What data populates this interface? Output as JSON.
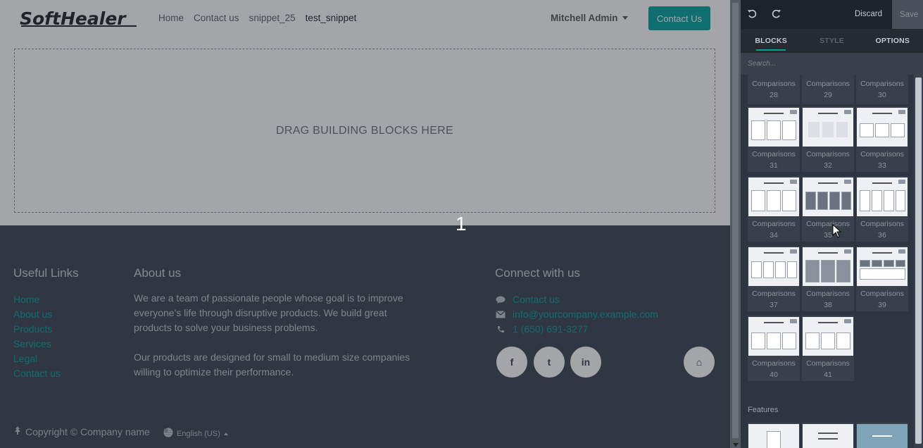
{
  "navbar": {
    "logo_text": "SoftHealer",
    "links": [
      {
        "label": "Home",
        "active": false
      },
      {
        "label": "Contact us",
        "active": false
      },
      {
        "label": "snippet_25",
        "active": false
      },
      {
        "label": "test_snippet",
        "active": true
      }
    ],
    "user": "Mitchell Admin",
    "cta_label": "Contact Us"
  },
  "main": {
    "dropzone_label": "DRAG BUILDING BLOCKS HERE",
    "hover_number": "1"
  },
  "footer": {
    "useful_links": {
      "title": "Useful Links",
      "items": [
        "Home",
        "About us",
        "Products",
        "Services",
        "Legal",
        "Contact us"
      ]
    },
    "about": {
      "title": "About us",
      "p1": "We are a team of passionate people whose goal is to improve everyone's life through disruptive products. We build great products to solve your business problems.",
      "p2": "Our products are designed for small to medium size companies willing to optimize their performance."
    },
    "connect": {
      "title": "Connect with us",
      "contact_label": "Contact us",
      "email": "info@yourcompany.example.com",
      "phone": "1 (650) 691-3277",
      "social": [
        {
          "icon": "facebook-icon",
          "glyph": "f"
        },
        {
          "icon": "twitter-icon",
          "glyph": "t"
        },
        {
          "icon": "linkedin-icon",
          "glyph": "in"
        },
        {
          "icon": "home-icon",
          "glyph": "⌂"
        }
      ]
    },
    "copyright": "Copyright © Company name",
    "language": "English (US)"
  },
  "editor": {
    "discard_label": "Discard",
    "save_label": "Save",
    "tabs": [
      "BLOCKS",
      "STYLE",
      "OPTIONS"
    ],
    "active_tab": "BLOCKS",
    "search_placeholder": "Search...",
    "blocks": [
      {
        "name": "Comparisons",
        "num": "28"
      },
      {
        "name": "Comparisons",
        "num": "29"
      },
      {
        "name": "Comparisons",
        "num": "30"
      },
      {
        "name": "Comparisons",
        "num": "31"
      },
      {
        "name": "Comparisons",
        "num": "32"
      },
      {
        "name": "Comparisons",
        "num": "33"
      },
      {
        "name": "Comparisons",
        "num": "34"
      },
      {
        "name": "Comparisons",
        "num": "35"
      },
      {
        "name": "Comparisons",
        "num": "36"
      },
      {
        "name": "Comparisons",
        "num": "37"
      },
      {
        "name": "Comparisons",
        "num": "38"
      },
      {
        "name": "Comparisons",
        "num": "39"
      },
      {
        "name": "Comparisons",
        "num": "40"
      },
      {
        "name": "Comparisons",
        "num": "41"
      }
    ],
    "next_category": "Features"
  },
  "colors": {
    "accent": "#00a09d",
    "footer_bg": "#3a4250",
    "editor_bg": "#2e3440"
  }
}
